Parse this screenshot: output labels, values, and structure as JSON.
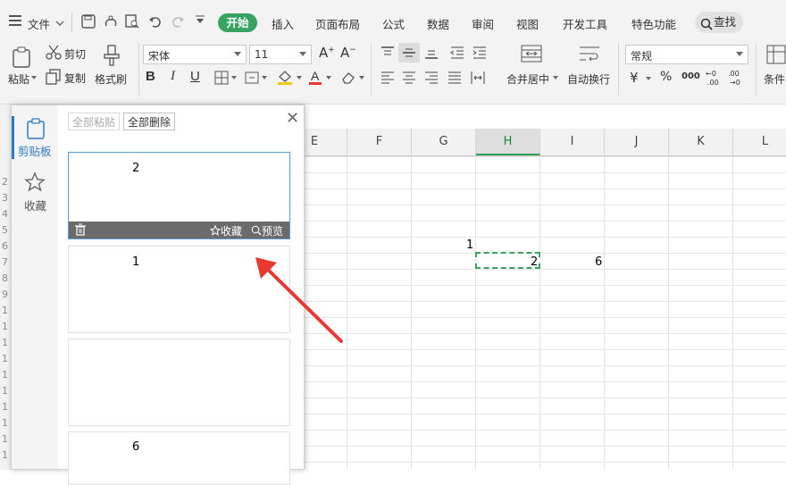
{
  "menubar": {
    "file_label": "文件",
    "tabs": [
      "插入",
      "页面布局",
      "公式",
      "数据",
      "审阅",
      "视图",
      "开发工具",
      "特色功能"
    ],
    "active_tab": "开始",
    "search_label": "查找"
  },
  "ribbon": {
    "paste": "粘贴",
    "cut": "剪切",
    "copy": "复制",
    "format_painter": "格式刷",
    "font_name": "宋体",
    "font_size": "11",
    "bold": "B",
    "italic": "I",
    "underline": "U",
    "merge_center": "合并居中",
    "auto_wrap": "自动换行",
    "number_format": "常规",
    "currency": "¥",
    "percent": "%",
    "thousands": "000",
    "condition": "条件"
  },
  "columns": [
    "E",
    "F",
    "G",
    "H",
    "I",
    "J",
    "K",
    "L"
  ],
  "selected_column": "H",
  "cells": [
    {
      "value": "1"
    },
    {
      "value": "2"
    },
    {
      "value": "6"
    }
  ],
  "row_numbers": [
    "2",
    "3",
    "4",
    "5",
    "6",
    "7",
    "8",
    "9",
    "1",
    "1",
    "1",
    "1",
    "1",
    "1",
    "1",
    "1",
    "1",
    "1",
    "2"
  ],
  "panel": {
    "tabs": [
      {
        "label": "剪贴板",
        "icon": "clipboard-icon"
      },
      {
        "label": "收藏",
        "icon": "star-icon"
      }
    ],
    "paste_all": "全部粘贴",
    "delete_all": "全部删除",
    "items": [
      {
        "value": "2"
      },
      {
        "value": "1"
      },
      {
        "value": ""
      },
      {
        "value": "6"
      }
    ],
    "card_actions": {
      "favorite": "收藏",
      "preview": "预览"
    }
  },
  "colors": {
    "accent_green": "#36a45e",
    "arrow_red": "#e8382f",
    "panel_blue": "#2b79c2"
  }
}
